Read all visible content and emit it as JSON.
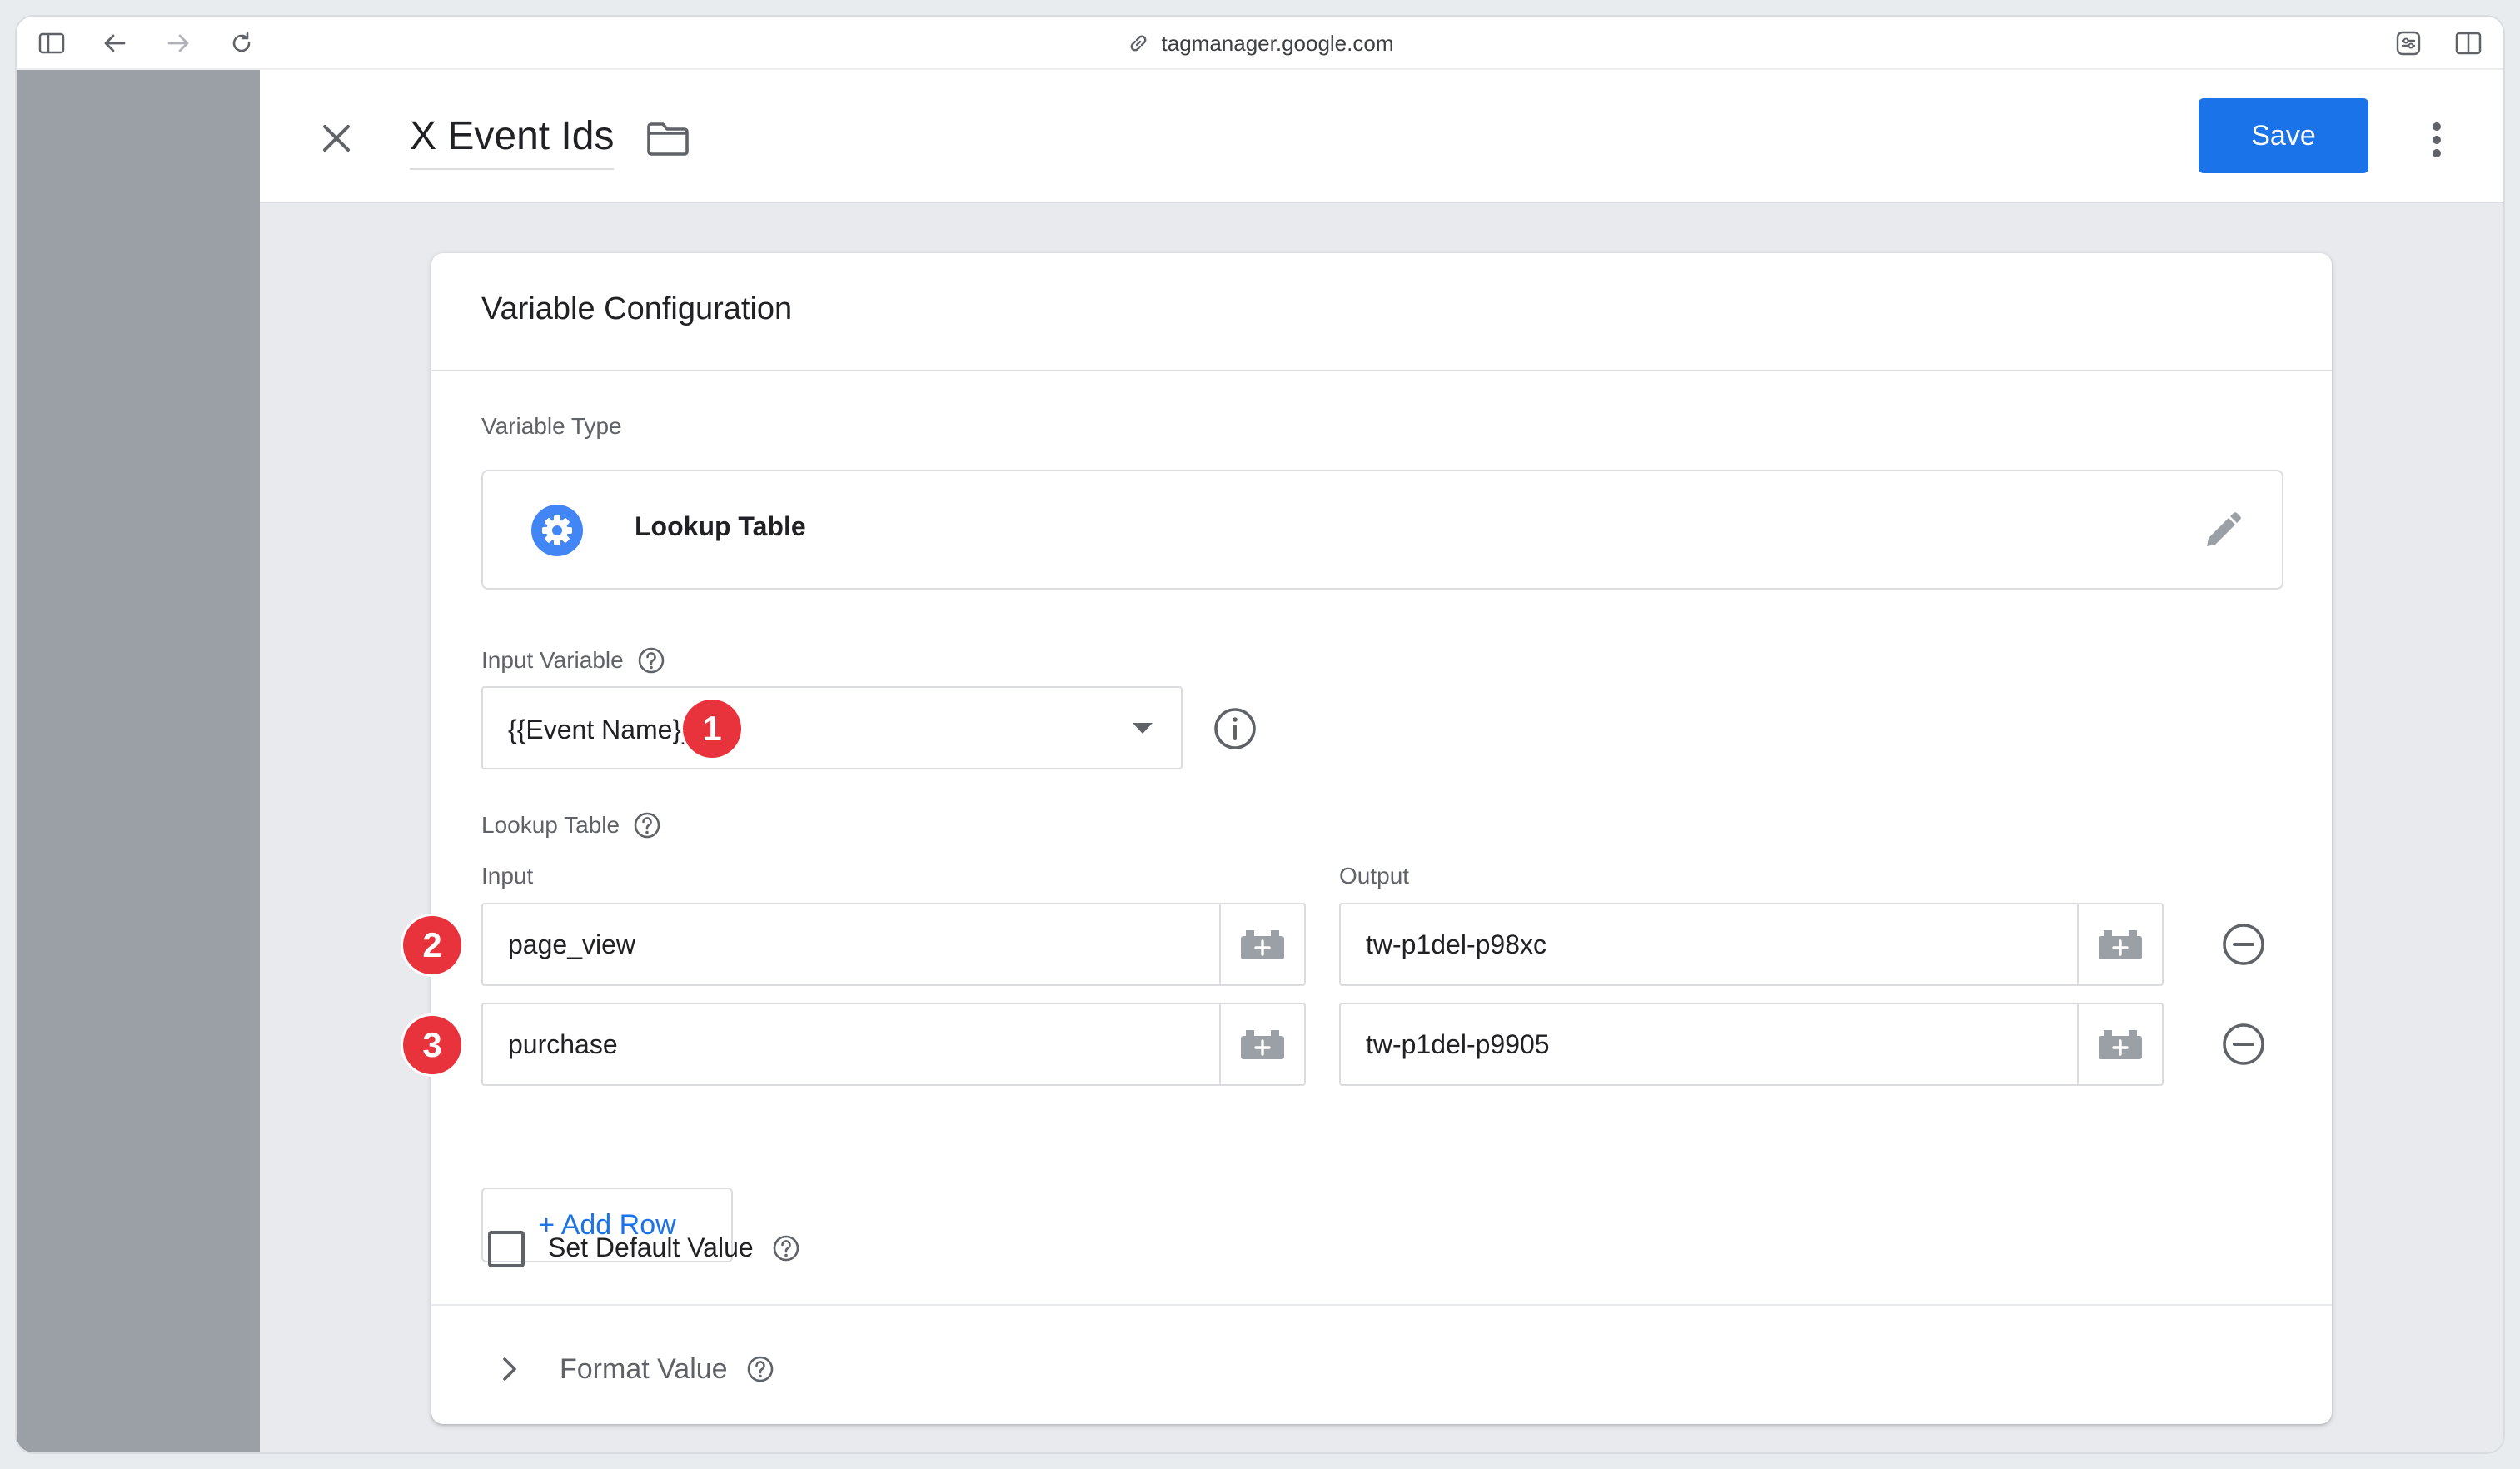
{
  "browser": {
    "url": "tagmanager.google.com"
  },
  "header": {
    "title": "X Event Ids",
    "save_label": "Save"
  },
  "card": {
    "title": "Variable Configuration",
    "variable_type_label": "Variable Type",
    "variable_type_value": "Lookup Table",
    "input_variable_label": "Input Variable",
    "input_variable_value": "{{Event Name}}",
    "lookup_table_label": "Lookup Table",
    "input_col": "Input",
    "output_col": "Output",
    "rows": [
      {
        "input": "page_view",
        "output": "tw-p1del-p98xc"
      },
      {
        "input": "purchase",
        "output": "tw-p1del-p9905"
      }
    ],
    "add_row_label": "+ Add Row",
    "default_value_label": "Set Default Value",
    "format_value_label": "Format Value"
  },
  "annotations": [
    "1",
    "2",
    "3"
  ],
  "colors": {
    "primary": "#1a73e8",
    "badge": "#e8323c",
    "gear": "#4285f4"
  }
}
